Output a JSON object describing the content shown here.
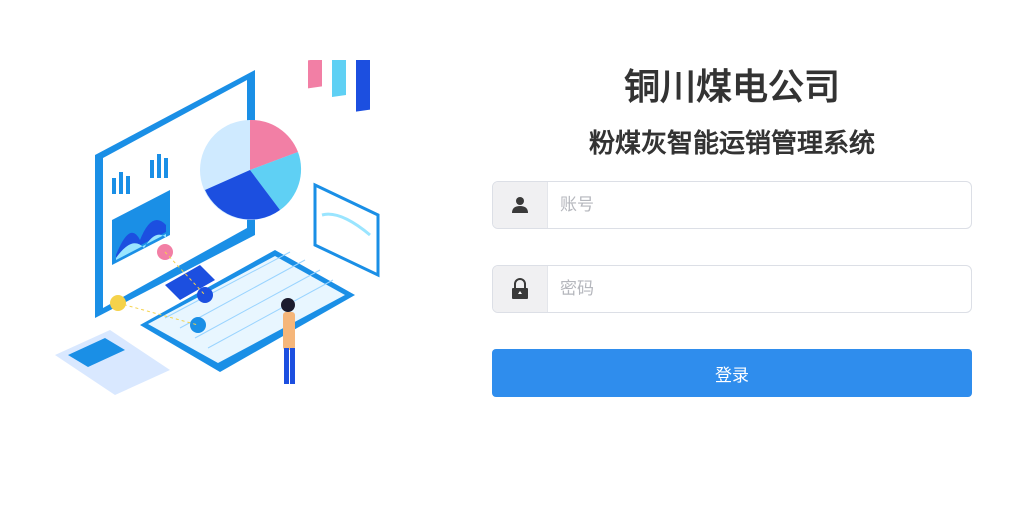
{
  "header": {
    "company_name": "铜川煤电公司",
    "system_name": "粉煤灰智能运销管理系统"
  },
  "form": {
    "username": {
      "placeholder": "账号",
      "icon": "user-icon"
    },
    "password": {
      "placeholder": "密码",
      "icon": "lock-icon"
    },
    "login_label": "登录"
  },
  "colors": {
    "primary": "#2f8ded",
    "title": "#333333",
    "addon_bg": "#f0f0f2"
  }
}
